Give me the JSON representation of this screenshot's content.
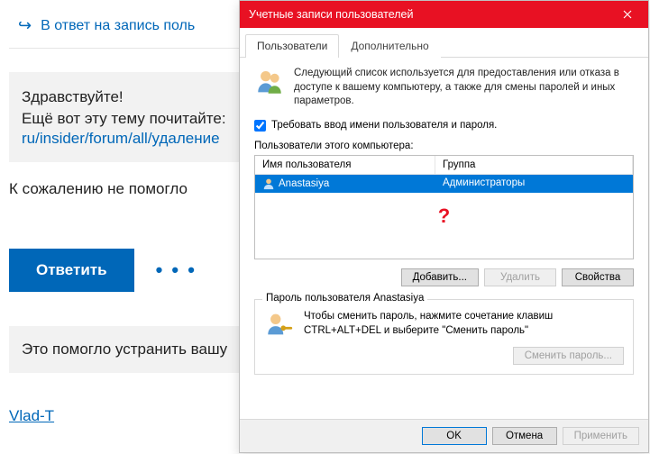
{
  "forum": {
    "reply_banner": "В ответ на запись поль",
    "greeting_line1": "Здравствуйте!",
    "greeting_line2": "Ещё вот эту тему почитайте:",
    "greeting_link": "ru/insider/forum/all/удаление",
    "not_helped": "К сожалению не помогло",
    "reply_button": "Ответить",
    "dots": "• • •",
    "feedback": "Это помогло устранить вашу",
    "vlad": "Vlad-T"
  },
  "dialog": {
    "title": "Учетные записи пользователей",
    "tabs": [
      "Пользователи",
      "Дополнительно"
    ],
    "intro": "Следующий список используется для предоставления или отказа в доступе к вашему компьютеру, а также для смены паролей и иных параметров.",
    "require_login": "Требовать ввод имени пользователя и пароля.",
    "list_label": "Пользователи этого компьютера:",
    "columns": {
      "user": "Имя пользователя",
      "group": "Группа"
    },
    "users": [
      {
        "name": "Anastasiya",
        "group": "Администраторы"
      }
    ],
    "qmark": "?",
    "buttons": {
      "add": "Добавить...",
      "delete": "Удалить",
      "props": "Свойства"
    },
    "group": {
      "title": "Пароль пользователя Anastasiya",
      "text": "Чтобы сменить пароль, нажмите сочетание клавиш CTRL+ALT+DEL и выберите \"Сменить пароль\"",
      "change": "Сменить пароль..."
    },
    "footer": {
      "ok": "OK",
      "cancel": "Отмена",
      "apply": "Применить"
    }
  }
}
